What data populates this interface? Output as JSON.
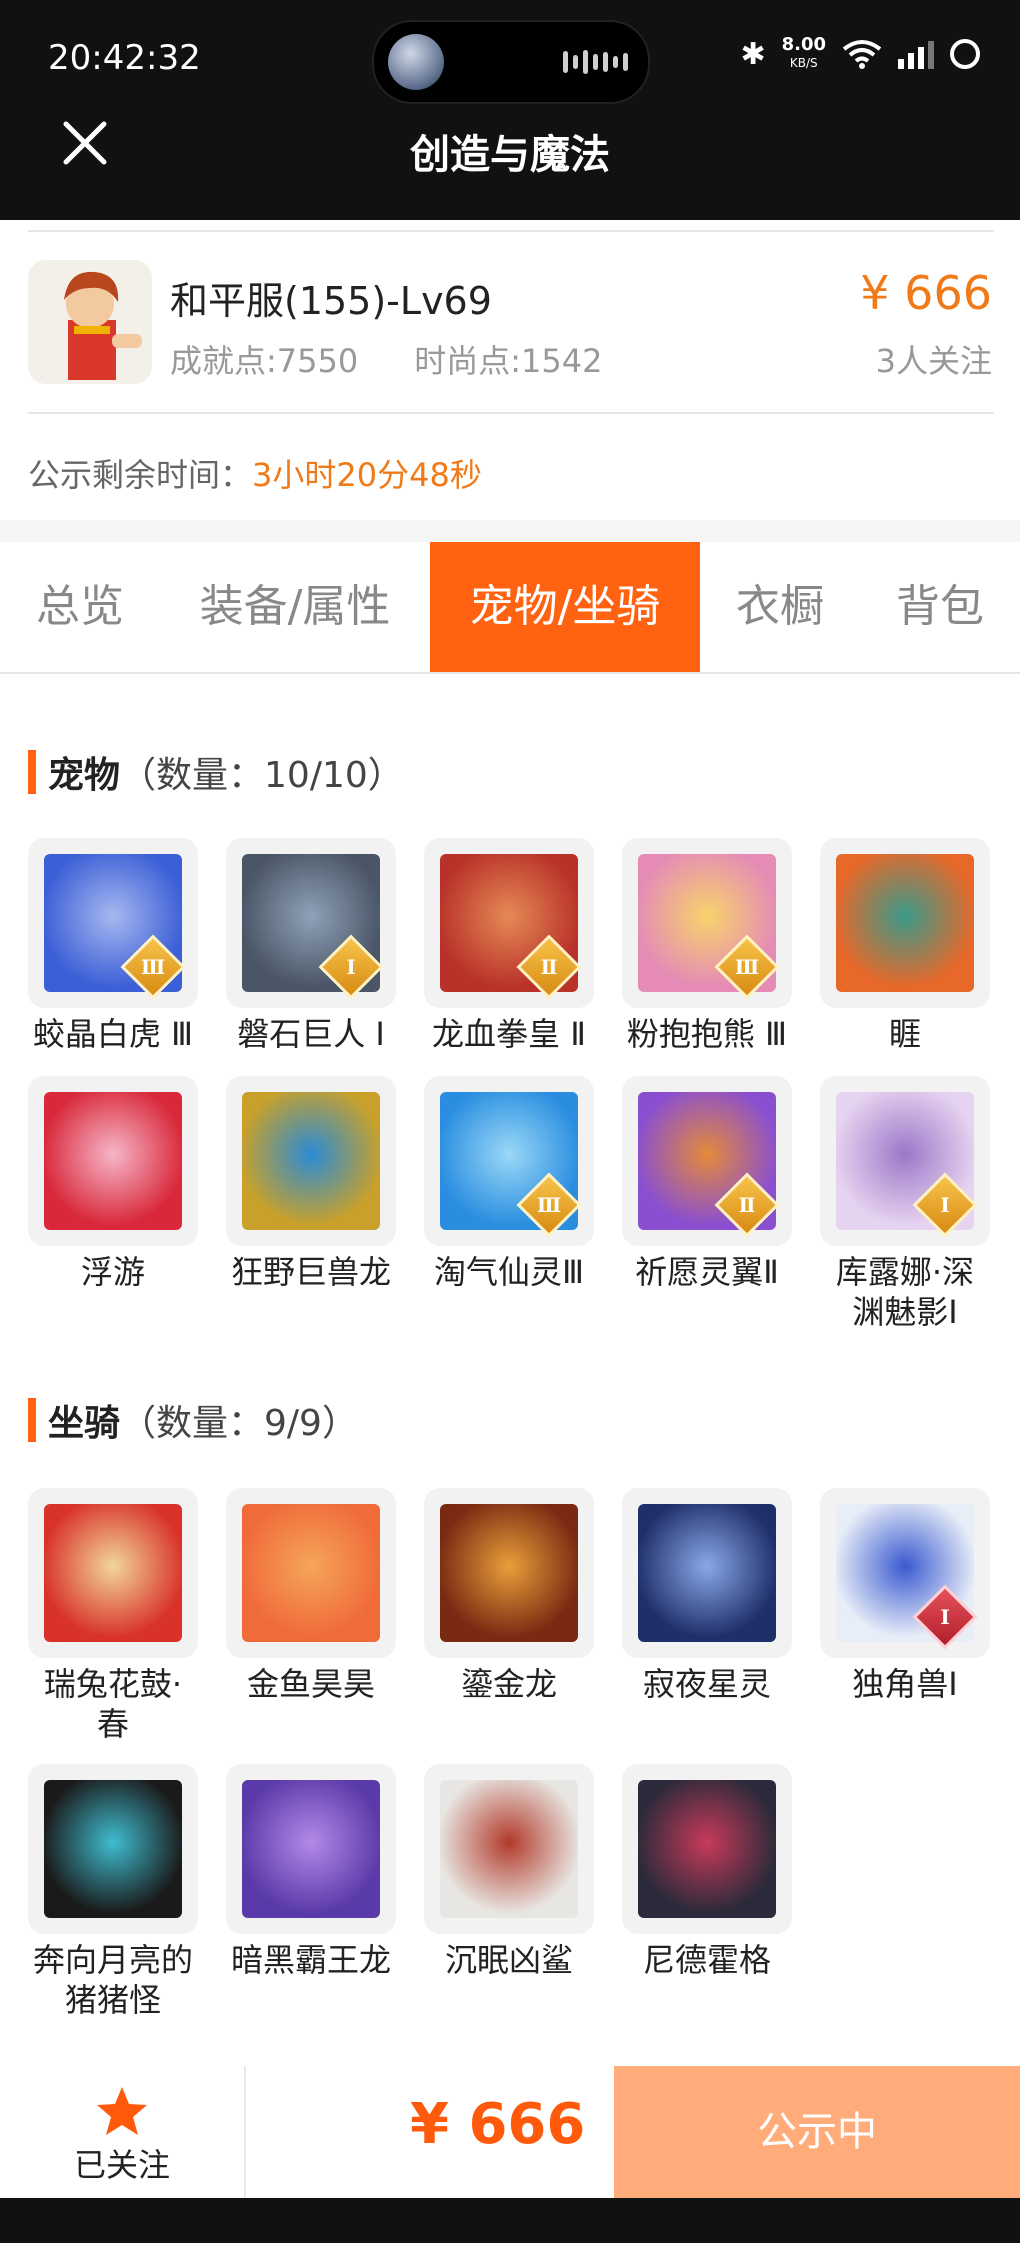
{
  "status_bar": {
    "time": "20:42:32",
    "speed_value": "8.00",
    "speed_unit": "KB/S",
    "network": "4G"
  },
  "header": {
    "title": "创造与魔法",
    "close_icon": "close-icon"
  },
  "listing": {
    "name": "和平服(155)-Lv69",
    "achievement": "成就点:7550",
    "fashion": "时尚点:1542",
    "price": "¥ 666",
    "followers": "3人关注",
    "countdown_label": "公示剩余时间：",
    "countdown_value": "3小时20分48秒"
  },
  "tabs": [
    {
      "label": "总览",
      "active": false
    },
    {
      "label": "装备/属性",
      "active": false
    },
    {
      "label": "宠物/坐骑",
      "active": true
    },
    {
      "label": "衣橱",
      "active": false
    },
    {
      "label": "背包",
      "active": false
    }
  ],
  "pets": {
    "title": "宠物",
    "count": "（数量：10/10）",
    "items": [
      {
        "name": "蛟晶白虎 Ⅲ",
        "badge": "Ⅲ"
      },
      {
        "name": "磐石巨人 Ⅰ",
        "badge": "Ⅰ"
      },
      {
        "name": "龙血拳皇 Ⅱ",
        "badge": "Ⅱ"
      },
      {
        "name": "粉抱抱熊 Ⅲ",
        "badge": "Ⅲ"
      },
      {
        "name": "睚",
        "badge": ""
      },
      {
        "name": "浮游",
        "badge": ""
      },
      {
        "name": "狂野巨兽龙",
        "badge": ""
      },
      {
        "name": "淘气仙灵Ⅲ",
        "badge": "Ⅲ"
      },
      {
        "name": "祈愿灵翼Ⅱ",
        "badge": "Ⅱ"
      },
      {
        "name": "库露娜·深渊魅影Ⅰ",
        "badge": "Ⅰ"
      }
    ]
  },
  "mounts": {
    "title": "坐骑",
    "count": "（数量：9/9）",
    "items": [
      {
        "name": "瑞兔花鼓·春",
        "badge": ""
      },
      {
        "name": "金鱼昊昊",
        "badge": ""
      },
      {
        "name": "鎏金龙",
        "badge": ""
      },
      {
        "name": "寂夜星灵",
        "badge": ""
      },
      {
        "name": "独角兽Ⅰ",
        "badge": "Ⅰ"
      },
      {
        "name": "奔向月亮的猪猪怪",
        "badge": ""
      },
      {
        "name": "暗黑霸王龙",
        "badge": ""
      },
      {
        "name": "沉眠凶鲨",
        "badge": ""
      },
      {
        "name": "尼德霍格",
        "badge": ""
      }
    ]
  },
  "bottom": {
    "follow_label": "已关注",
    "price": "¥ 666",
    "status_label": "公示中"
  },
  "colors": {
    "accent": "#ff6312",
    "price": "#f07a17",
    "status_button": "#ffab7a"
  }
}
